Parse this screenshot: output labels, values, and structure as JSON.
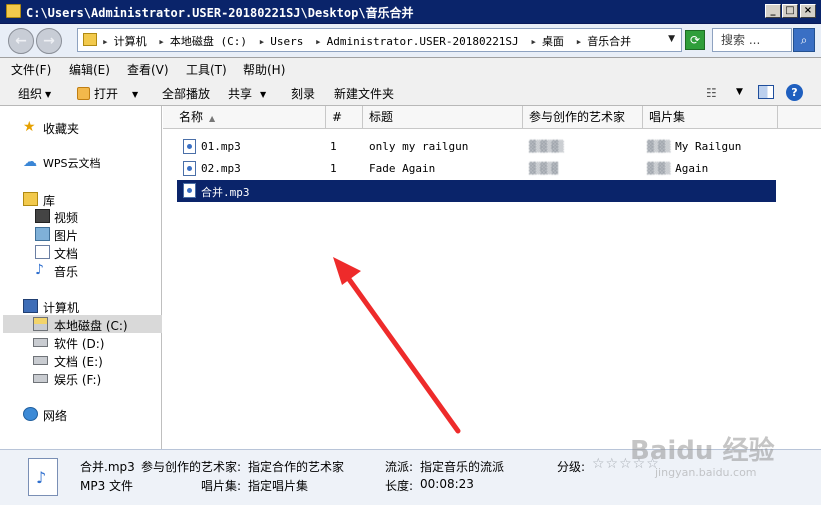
{
  "window": {
    "title": "C:\\Users\\Administrator.USER-20180221SJ\\Desktop\\音乐合并"
  },
  "address": {
    "crumbs": [
      "计算机",
      "本地磁盘 (C:)",
      "Users",
      "Administrator.USER-20180221SJ",
      "桌面",
      "音乐合并"
    ],
    "search_placeholder": "搜索 ..."
  },
  "menu": [
    "文件(F)",
    "编辑(E)",
    "查看(V)",
    "工具(T)",
    "帮助(H)"
  ],
  "commands": {
    "organize": "组织",
    "open": "打开",
    "play_all": "全部播放",
    "share": "共享",
    "burn": "刻录",
    "new_folder": "新建文件夹"
  },
  "nav": {
    "favorites": "收藏夹",
    "wps_cloud": "WPS云文档",
    "library": "库",
    "video": "视频",
    "pictures": "图片",
    "documents": "文档",
    "music": "音乐",
    "computer": "计算机",
    "drive_c": "本地磁盘 (C:)",
    "drive_d": "软件 (D:)",
    "drive_e": "文档 (E:)",
    "drive_f": "娱乐 (F:)",
    "network": "网络"
  },
  "columns": {
    "name": "名称",
    "track": "#",
    "title": "标题",
    "artist": "参与创作的艺术家",
    "album": "唱片集"
  },
  "files": [
    {
      "name": "01.mp3",
      "track": "1",
      "title": "only my railgun",
      "artist": "",
      "album": "My Railgun"
    },
    {
      "name": "02.mp3",
      "track": "1",
      "title": "Fade Again",
      "artist": "",
      "album": "Again"
    },
    {
      "name": "合并.mp3",
      "track": "",
      "title": "",
      "artist": "",
      "album": ""
    }
  ],
  "details": {
    "filename": "合并.mp3",
    "filetype": "MP3 文件",
    "artist_label": "参与创作的艺术家:",
    "artist_value": "指定合作的艺术家",
    "album_label": "唱片集:",
    "album_value": "指定唱片集",
    "genre_label": "流派:",
    "genre_value": "指定音乐的流派",
    "length_label": "长度:",
    "length_value": "00:08:23",
    "rating_label": "分级:",
    "rating_stars": "☆☆☆☆☆"
  },
  "watermark": {
    "main": "Baidu 经验",
    "sub": "jingyan.baidu.com"
  }
}
